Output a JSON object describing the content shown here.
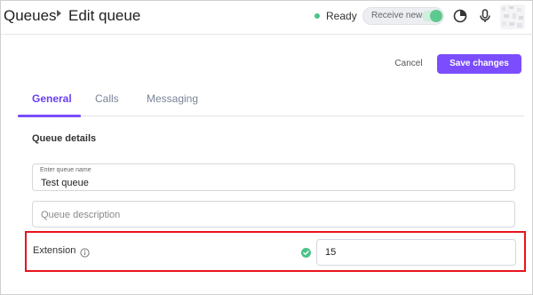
{
  "breadcrumb": {
    "root": "Queues",
    "current": "Edit queue"
  },
  "status": {
    "label": "Ready",
    "color": "#4cc38a"
  },
  "receive_toggle": {
    "label": "Receive new",
    "on": true
  },
  "header_icons": [
    "pie-chart-icon",
    "microphone-icon",
    "avatar"
  ],
  "actions": {
    "cancel": "Cancel",
    "save": "Save changes",
    "accent": "#7b4dff"
  },
  "tabs": [
    {
      "label": "General",
      "active": true
    },
    {
      "label": "Calls",
      "active": false
    },
    {
      "label": "Messaging",
      "active": false
    }
  ],
  "section": {
    "title": "Queue details"
  },
  "queue_name": {
    "label": "Enter queue name",
    "value": "Test queue"
  },
  "queue_description": {
    "placeholder": "Queue description",
    "value": ""
  },
  "extension": {
    "label": "Extension",
    "value": "15",
    "valid": true
  },
  "highlight_color": "#e8141b"
}
